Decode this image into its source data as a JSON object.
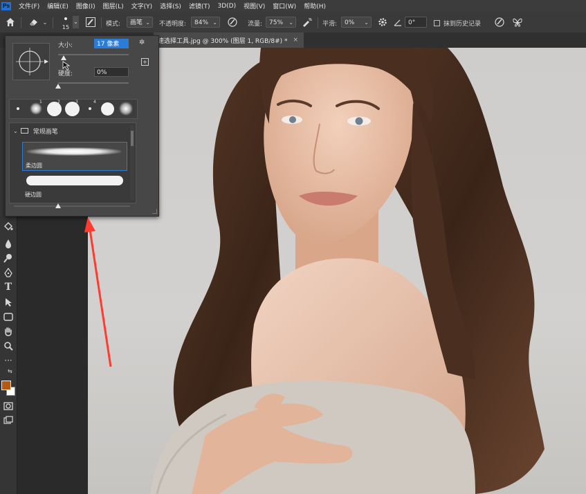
{
  "app": {
    "logo_text": "Ps"
  },
  "menu": [
    "文件(F)",
    "编辑(E)",
    "图像(I)",
    "图层(L)",
    "文字(Y)",
    "选择(S)",
    "滤镜(T)",
    "3D(D)",
    "视图(V)",
    "窗口(W)",
    "帮助(H)"
  ],
  "options": {
    "brush_size_value": "15",
    "mode_label": "模式:",
    "mode_value": "画笔",
    "opacity_label": "不透明度:",
    "opacity_value": "84%",
    "flow_label": "流量:",
    "flow_value": "75%",
    "smoothing_label": "平滑:",
    "smoothing_value": "0%",
    "angle_value": "0°",
    "erase_history_label": "抹到历史记录"
  },
  "document_tab": {
    "title": "速选择工具.jpg @ 300% (图层 1, RGB/8#) *",
    "close": "×"
  },
  "brush_panel": {
    "size_label": "大小:",
    "size_value": "17 像素",
    "hardness_label": "硬度:",
    "hardness_value": "0%",
    "folder_name": "常规画笔",
    "brushes": [
      {
        "name": "柔边圆",
        "selected": true
      },
      {
        "name": "硬边圆",
        "selected": false
      }
    ],
    "preset_numbers": [
      "1",
      "2",
      "3",
      "4"
    ]
  },
  "colors": {
    "foreground": "#b35a10",
    "background": "#ffffff",
    "accent": "#2b7cd6",
    "arrow": "#ff3b30"
  },
  "icons": [
    "home-icon",
    "eraser-icon",
    "brush-settings-icon",
    "airbrush-icon",
    "pressure-opacity-icon",
    "gear-icon",
    "angle-icon",
    "symmetry-icon",
    "butterfly-icon"
  ]
}
